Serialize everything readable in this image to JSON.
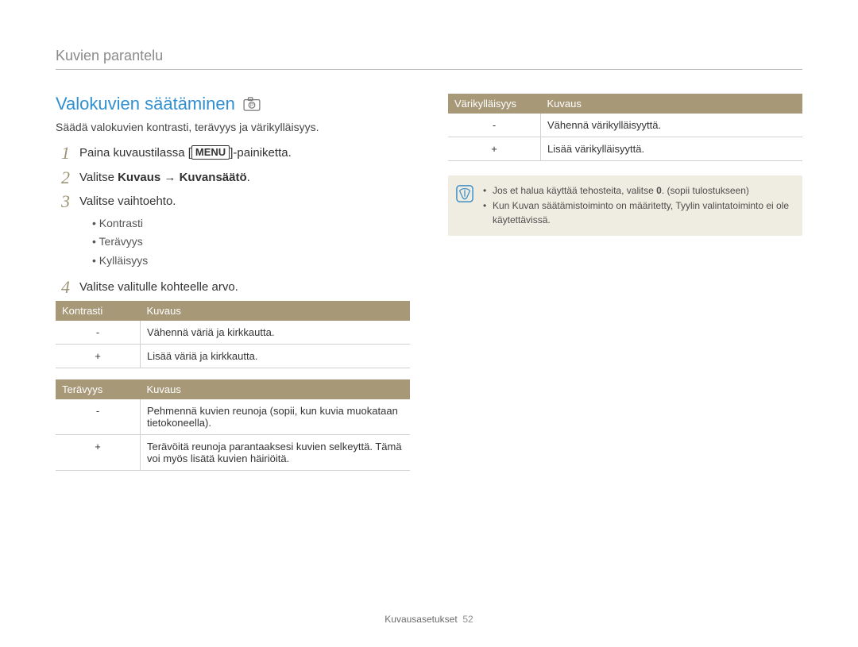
{
  "header": {
    "section": "Kuvien parantelu"
  },
  "left": {
    "heading": "Valokuvien säätäminen",
    "camera_icon": "camera-p-icon",
    "intro": "Säädä valokuvien kontrasti, terävyys ja värikylläisyys.",
    "step1_pre": "Paina kuvaustilassa [",
    "step1_menu": "MENU",
    "step1_post": "]-painiketta.",
    "step2_pre": "Valitse ",
    "step2_bold": "Kuvaus → Kuvansäätö",
    "step2_post": ".",
    "step3": "Valitse vaihtoehto.",
    "bullets": [
      "Kontrasti",
      "Terävyys",
      "Kylläisyys"
    ],
    "step4": "Valitse valitulle kohteelle arvo.",
    "table1": {
      "h1": "Kontrasti",
      "h2": "Kuvaus",
      "rows": [
        {
          "sym": "-",
          "desc": "Vähennä väriä ja kirkkautta."
        },
        {
          "sym": "+",
          "desc": "Lisää väriä ja kirkkautta."
        }
      ]
    },
    "table2": {
      "h1": "Terävyys",
      "h2": "Kuvaus",
      "rows": [
        {
          "sym": "-",
          "desc": "Pehmennä kuvien reunoja (sopii, kun kuvia muokataan tietokoneella)."
        },
        {
          "sym": "+",
          "desc": "Terävöitä reunoja parantaaksesi kuvien selkeyttä. Tämä voi myös lisätä kuvien häiriöitä."
        }
      ]
    }
  },
  "right": {
    "table": {
      "h1": "Värikylläisyys",
      "h2": "Kuvaus",
      "rows": [
        {
          "sym": "-",
          "desc": "Vähennä värikylläisyyttä."
        },
        {
          "sym": "+",
          "desc": "Lisää värikylläisyyttä."
        }
      ]
    },
    "notes": [
      {
        "pre": "Jos et halua käyttää tehosteita, valitse ",
        "bold": "0",
        "post": ". (sopii tulostukseen)"
      },
      {
        "text": "Kun Kuvan säätämistoiminto on määritetty, Tyylin valintatoiminto ei ole käytettävissä."
      }
    ]
  },
  "footer": {
    "label": "Kuvausasetukset",
    "page": "52"
  }
}
